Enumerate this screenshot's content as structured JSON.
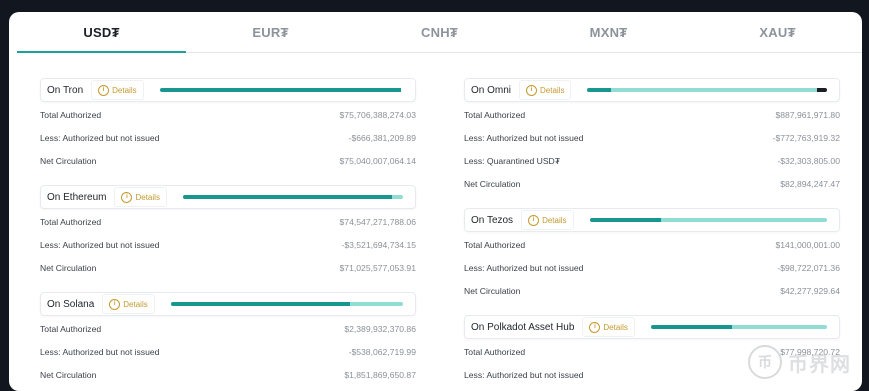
{
  "tabs": [
    {
      "label": "USD₮",
      "active": true
    },
    {
      "label": "EUR₮",
      "active": false
    },
    {
      "label": "CNH₮",
      "active": false
    },
    {
      "label": "MXN₮",
      "active": false
    },
    {
      "label": "XAU₮",
      "active": false
    }
  ],
  "details_label": "Details",
  "colors": {
    "accent": "#17978f",
    "accent_light": "#91dcd3",
    "details": "#c59a2f"
  },
  "left": [
    {
      "name": "On Tron",
      "bar": [
        {
          "v": 0.99,
          "c": "a"
        }
      ],
      "rows": [
        {
          "label": "Total Authorized",
          "value": "$75,706,388,274.03"
        },
        {
          "label": "Less: Authorized but not issued",
          "value": "-$666,381,209.89"
        },
        {
          "label": "Net Circulation",
          "value": "$75,040,007,064.14"
        }
      ]
    },
    {
      "name": "On Ethereum",
      "bar": [
        {
          "v": 0.95,
          "c": "a"
        },
        {
          "v": 0.05,
          "c": "b"
        }
      ],
      "rows": [
        {
          "label": "Total Authorized",
          "value": "$74,547,271,788.06"
        },
        {
          "label": "Less: Authorized but not issued",
          "value": "-$3,521,694,734.15"
        },
        {
          "label": "Net Circulation",
          "value": "$71,025,577,053.91"
        }
      ]
    },
    {
      "name": "On Solana",
      "bar": [
        {
          "v": 0.77,
          "c": "a"
        },
        {
          "v": 0.23,
          "c": "b"
        }
      ],
      "rows": [
        {
          "label": "Total Authorized",
          "value": "$2,389,932,370.86"
        },
        {
          "label": "Less: Authorized but not issued",
          "value": "-$538,062,719.99"
        },
        {
          "label": "Net Circulation",
          "value": "$1,851,869,650.87"
        }
      ]
    }
  ],
  "right": [
    {
      "name": "On Omni",
      "bar": [
        {
          "v": 0.1,
          "c": "a"
        },
        {
          "v": 0.86,
          "c": "b"
        },
        {
          "v": 0.04,
          "c": "c"
        }
      ],
      "rows": [
        {
          "label": "Total Authorized",
          "value": "$887,961,971.80"
        },
        {
          "label": "Less: Authorized but not issued",
          "value": "-$772,763,919.32"
        },
        {
          "label": "Less: Quarantined USD₮",
          "value": "-$32,303,805.00"
        },
        {
          "label": "Net Circulation",
          "value": "$82,894,247.47"
        }
      ]
    },
    {
      "name": "On Tezos",
      "bar": [
        {
          "v": 0.3,
          "c": "a"
        },
        {
          "v": 0.7,
          "c": "b"
        }
      ],
      "rows": [
        {
          "label": "Total Authorized",
          "value": "$141,000,001.00"
        },
        {
          "label": "Less: Authorized but not issued",
          "value": "-$98,722,071.36"
        },
        {
          "label": "Net Circulation",
          "value": "$42,277,929.64"
        }
      ]
    },
    {
      "name": "On Polkadot Asset Hub",
      "bar": [
        {
          "v": 0.46,
          "c": "a"
        },
        {
          "v": 0.54,
          "c": "b"
        }
      ],
      "rows": [
        {
          "label": "Total Authorized",
          "value": "$77,998,720.72"
        },
        {
          "label": "Less: Authorized but not issued",
          "value": ""
        }
      ]
    }
  ],
  "watermark": {
    "glyph": "币",
    "text": "币界网"
  }
}
